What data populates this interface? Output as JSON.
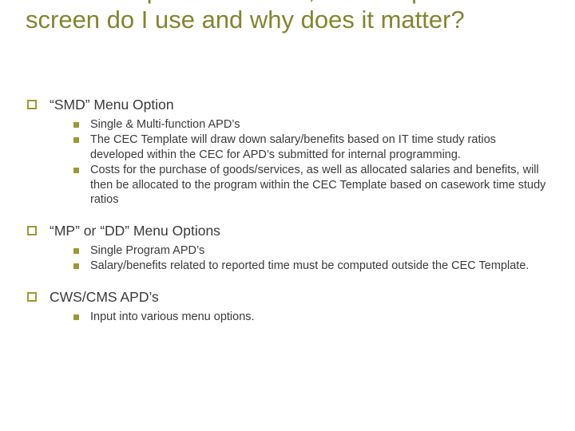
{
  "title": "For Developmental APD's, which input screen do I use and why does it matter?",
  "sections": [
    {
      "heading": "“SMD” Menu Option",
      "items": [
        "Single & Multi-function APD’s",
        "The CEC Template will draw down salary/benefits based on IT time study ratios developed within the CEC for APD’s submitted for internal programming.",
        "Costs for the purchase of goods/services, as well as allocated salaries and benefits, will then be allocated to the program within the CEC Template based on casework time study ratios"
      ]
    },
    {
      "heading": "“MP” or “DD” Menu Options",
      "items": [
        "Single Program APD’s",
        "Salary/benefits related to reported time must be computed outside the CEC Template."
      ]
    },
    {
      "heading": "CWS/CMS APD’s",
      "items": [
        "Input into various menu options."
      ]
    }
  ]
}
